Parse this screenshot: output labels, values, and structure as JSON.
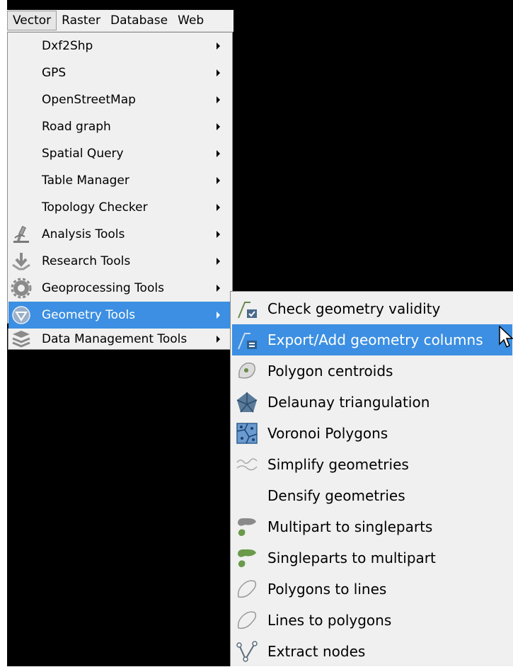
{
  "menubar": {
    "items": [
      {
        "label": "Vector"
      },
      {
        "label": "Raster"
      },
      {
        "label": "Database"
      },
      {
        "label": "Web"
      }
    ]
  },
  "vector_menu": {
    "items": [
      {
        "label": "Dxf2Shp",
        "icon": ""
      },
      {
        "label": "GPS",
        "icon": ""
      },
      {
        "label": "OpenStreetMap",
        "icon": ""
      },
      {
        "label": "Road graph",
        "icon": ""
      },
      {
        "label": "Spatial Query",
        "icon": ""
      },
      {
        "label": "Table Manager",
        "icon": ""
      },
      {
        "label": "Topology Checker",
        "icon": ""
      },
      {
        "label": "Analysis Tools",
        "icon": "microscope-icon"
      },
      {
        "label": "Research Tools",
        "icon": "research-icon"
      },
      {
        "label": "Geoprocessing Tools",
        "icon": "gear-icon"
      },
      {
        "label": "Geometry Tools",
        "icon": "geometry-icon",
        "highlighted": true
      },
      {
        "label": "Data Management Tools",
        "icon": "layers-icon"
      }
    ]
  },
  "geometry_submenu": {
    "items": [
      {
        "label": "Check geometry validity",
        "icon": "check-validity-icon"
      },
      {
        "label": "Export/Add geometry columns",
        "icon": "export-columns-icon",
        "highlighted": true
      },
      {
        "label": "Polygon centroids",
        "icon": "centroids-icon"
      },
      {
        "label": "Delaunay triangulation",
        "icon": "delaunay-icon"
      },
      {
        "label": "Voronoi Polygons",
        "icon": "voronoi-icon"
      },
      {
        "label": "Simplify geometries",
        "icon": "simplify-icon"
      },
      {
        "label": "Densify geometries",
        "icon": ""
      },
      {
        "label": "Multipart to singleparts",
        "icon": "multipart-icon"
      },
      {
        "label": "Singleparts to multipart",
        "icon": "singleparts-icon"
      },
      {
        "label": "Polygons to lines",
        "icon": "polygon-outline-icon"
      },
      {
        "label": "Lines to polygons",
        "icon": "polygon-outline-icon"
      },
      {
        "label": "Extract nodes",
        "icon": "nodes-icon"
      }
    ]
  },
  "colors": {
    "highlight": "#3c8fe2",
    "menu_bg": "#f0f0f0",
    "background": "#000000"
  }
}
